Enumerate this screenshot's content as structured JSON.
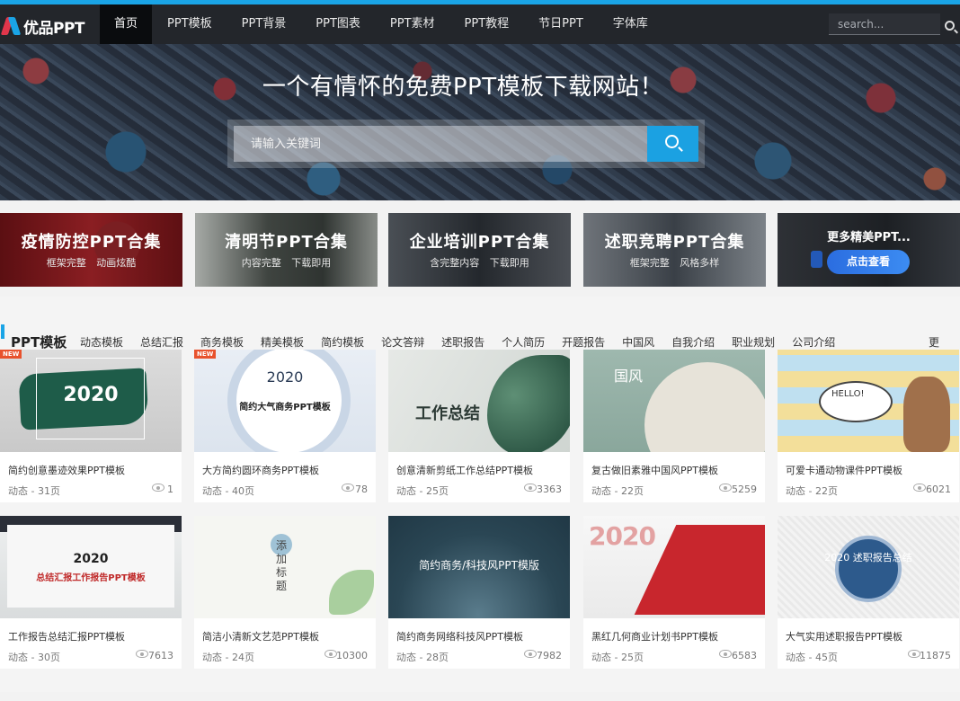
{
  "header": {
    "logo_text": "优品PPT",
    "nav": [
      "首页",
      "PPT模板",
      "PPT背景",
      "PPT图表",
      "PPT素材",
      "PPT教程",
      "节日PPT",
      "字体库"
    ],
    "search_placeholder": "search..."
  },
  "banner": {
    "title": "一个有情怀的免费PPT模板下载网站！",
    "search_placeholder": "请输入关键词"
  },
  "promos": [
    {
      "title": "疫情防控PPT合集",
      "subtitle": "框架完整 动画炫酷"
    },
    {
      "title": "清明节PPT合集",
      "subtitle": "内容完整 下载即用"
    },
    {
      "title": "企业培训PPT合集",
      "subtitle": "含完整内容 下载即用"
    },
    {
      "title": "述职竞聘PPT合集",
      "subtitle": "框架完整 风格多样"
    },
    {
      "title": "更多精美PPT...",
      "button": "点击查看"
    }
  ],
  "section": {
    "title": "PPT模板",
    "categories": [
      "动态模板",
      "总结汇报",
      "商务模板",
      "精美模板",
      "简约模板",
      "论文答辩",
      "述职报告",
      "个人简历",
      "开题报告",
      "中国风",
      "自我介绍",
      "职业规划",
      "公司介绍"
    ],
    "more": "更多..."
  },
  "cards": [
    {
      "title": "简约创意墨迹效果PPT模板",
      "meta": "动态 - 31页",
      "views": "1",
      "badge": "NEW",
      "thumb_text": "2020"
    },
    {
      "title": "大方简约圆环商务PPT模板",
      "meta": "动态 - 40页",
      "views": "78",
      "badge": "NEW",
      "thumb_text": "2020",
      "thumb_sub": "简约大气商务PPT模板"
    },
    {
      "title": "创意清新剪纸工作总结PPT模板",
      "meta": "动态 - 25页",
      "views": "3363",
      "thumb_text": "工作总结"
    },
    {
      "title": "复古做旧素雅中国风PPT模板",
      "meta": "动态 - 22页",
      "views": "5259",
      "thumb_text": "国风"
    },
    {
      "title": "可爱卡通动物课件PPT模板",
      "meta": "动态 - 22页",
      "views": "6021",
      "thumb_text": "HELLO!"
    },
    {
      "title": "工作报告总结汇报PPT模板",
      "meta": "动态 - 30页",
      "views": "7613",
      "thumb_text": "2020",
      "thumb_sub": "总结汇报工作报告PPT模板"
    },
    {
      "title": "简洁小清新文艺范PPT模板",
      "meta": "动态 - 24页",
      "views": "10300",
      "thumb_text": "添加标题"
    },
    {
      "title": "简约商务网络科技风PPT模板",
      "meta": "动态 - 28页",
      "views": "7982",
      "thumb_text": "简约商务/科技风PPT模版"
    },
    {
      "title": "黑红几何商业计划书PPT模板",
      "meta": "动态 - 25页",
      "views": "6583",
      "thumb_text": "2020"
    },
    {
      "title": "大气实用述职报告PPT模板",
      "meta": "动态 - 45页",
      "views": "11875",
      "thumb_text": "2020 述职报告总结"
    }
  ],
  "colors": {
    "accent": "#1aa4e6",
    "topbar": "#23262b",
    "badge": "#e8522d"
  }
}
